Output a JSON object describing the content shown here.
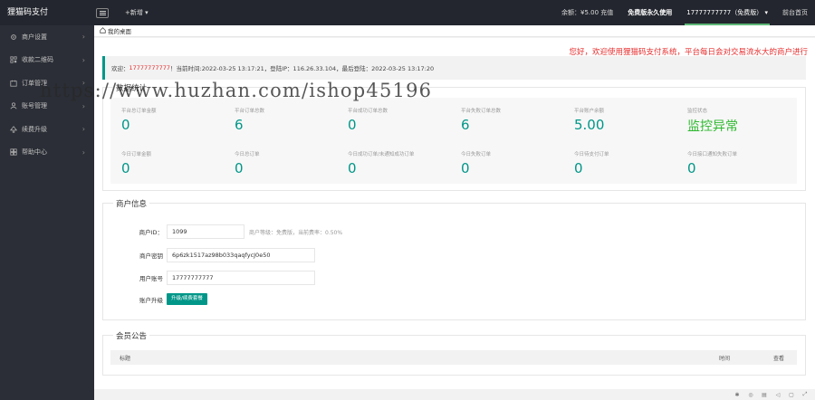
{
  "topbar": {
    "logo": "狸猫码支付",
    "new_label": "+新增 ▾",
    "balance": "余额：¥5.00 充值",
    "free_use": "免费版永久使用",
    "user": "17777777777（免费版） ▾",
    "backend_home": "前台首页"
  },
  "sidebar": {
    "items": [
      {
        "label": "商户设置",
        "icon": "gear-icon"
      },
      {
        "label": "收款二维码",
        "icon": "qrcode-icon"
      },
      {
        "label": "订单管理",
        "icon": "order-icon"
      },
      {
        "label": "账号管理",
        "icon": "user-icon"
      },
      {
        "label": "续费升级",
        "icon": "upgrade-icon"
      },
      {
        "label": "帮助中心",
        "icon": "help-icon"
      }
    ]
  },
  "tab": {
    "label": "我的桌面"
  },
  "main": {
    "welcome_banner": "您好，欢迎使用狸猫码支付系统，平台每日会对交易流水大的商户进行",
    "notice": {
      "prefix": "欢迎：",
      "user": "17777777777",
      "rest": "！当前时间:2022-03-25 13:17:21，登陆IP：116.26.33.104，最后登陆：2022-03-25 13:17:20"
    },
    "stats_title": "数据统计",
    "stats": [
      {
        "label": "平台总订单金额",
        "value": "0"
      },
      {
        "label": "平台订单总数",
        "value": "6"
      },
      {
        "label": "平台成功订单总数",
        "value": "0"
      },
      {
        "label": "平台失败订单总数",
        "value": "6"
      },
      {
        "label": "平台账户余额",
        "value": "5.00"
      },
      {
        "label": "监控状态",
        "value": "监控异常"
      },
      {
        "label": "今日订单金额",
        "value": "0"
      },
      {
        "label": "今日总订单",
        "value": "0"
      },
      {
        "label": "今日成功订单/未通知成功订单",
        "value": "0"
      },
      {
        "label": "今日失败订单",
        "value": "0"
      },
      {
        "label": "今日待支付订单",
        "value": "0"
      },
      {
        "label": "今日接口通知失败订单",
        "value": "0"
      }
    ],
    "merchant_title": "商户信息",
    "merchant": {
      "id_label": "商户ID：",
      "id_value": "1099",
      "id_hint": "商户等级：免费版，当前费率：0.50%",
      "key_label": "商户密钥",
      "key_value": "6p6zk1517az98b033qaqfycJ0e50",
      "account_label": "用户账号",
      "account_value": "17777777777",
      "upgrade_label": "账户升级",
      "upgrade_button": "升级/续费套餐"
    },
    "members_title": "会员公告",
    "members_columns": [
      "标题",
      "时间",
      "查看"
    ]
  },
  "footer_icons": [
    "bug-icon",
    "refresh-icon",
    "note-icon",
    "sound-icon",
    "fullscreen-icon",
    "expand-icon"
  ],
  "watermark": "https://www.huzhan.com/ishop45196",
  "colors": {
    "accent": "#009688",
    "topbar": "#23262e",
    "sidebar": "#2b2e36",
    "alert": "#e62d2d"
  }
}
